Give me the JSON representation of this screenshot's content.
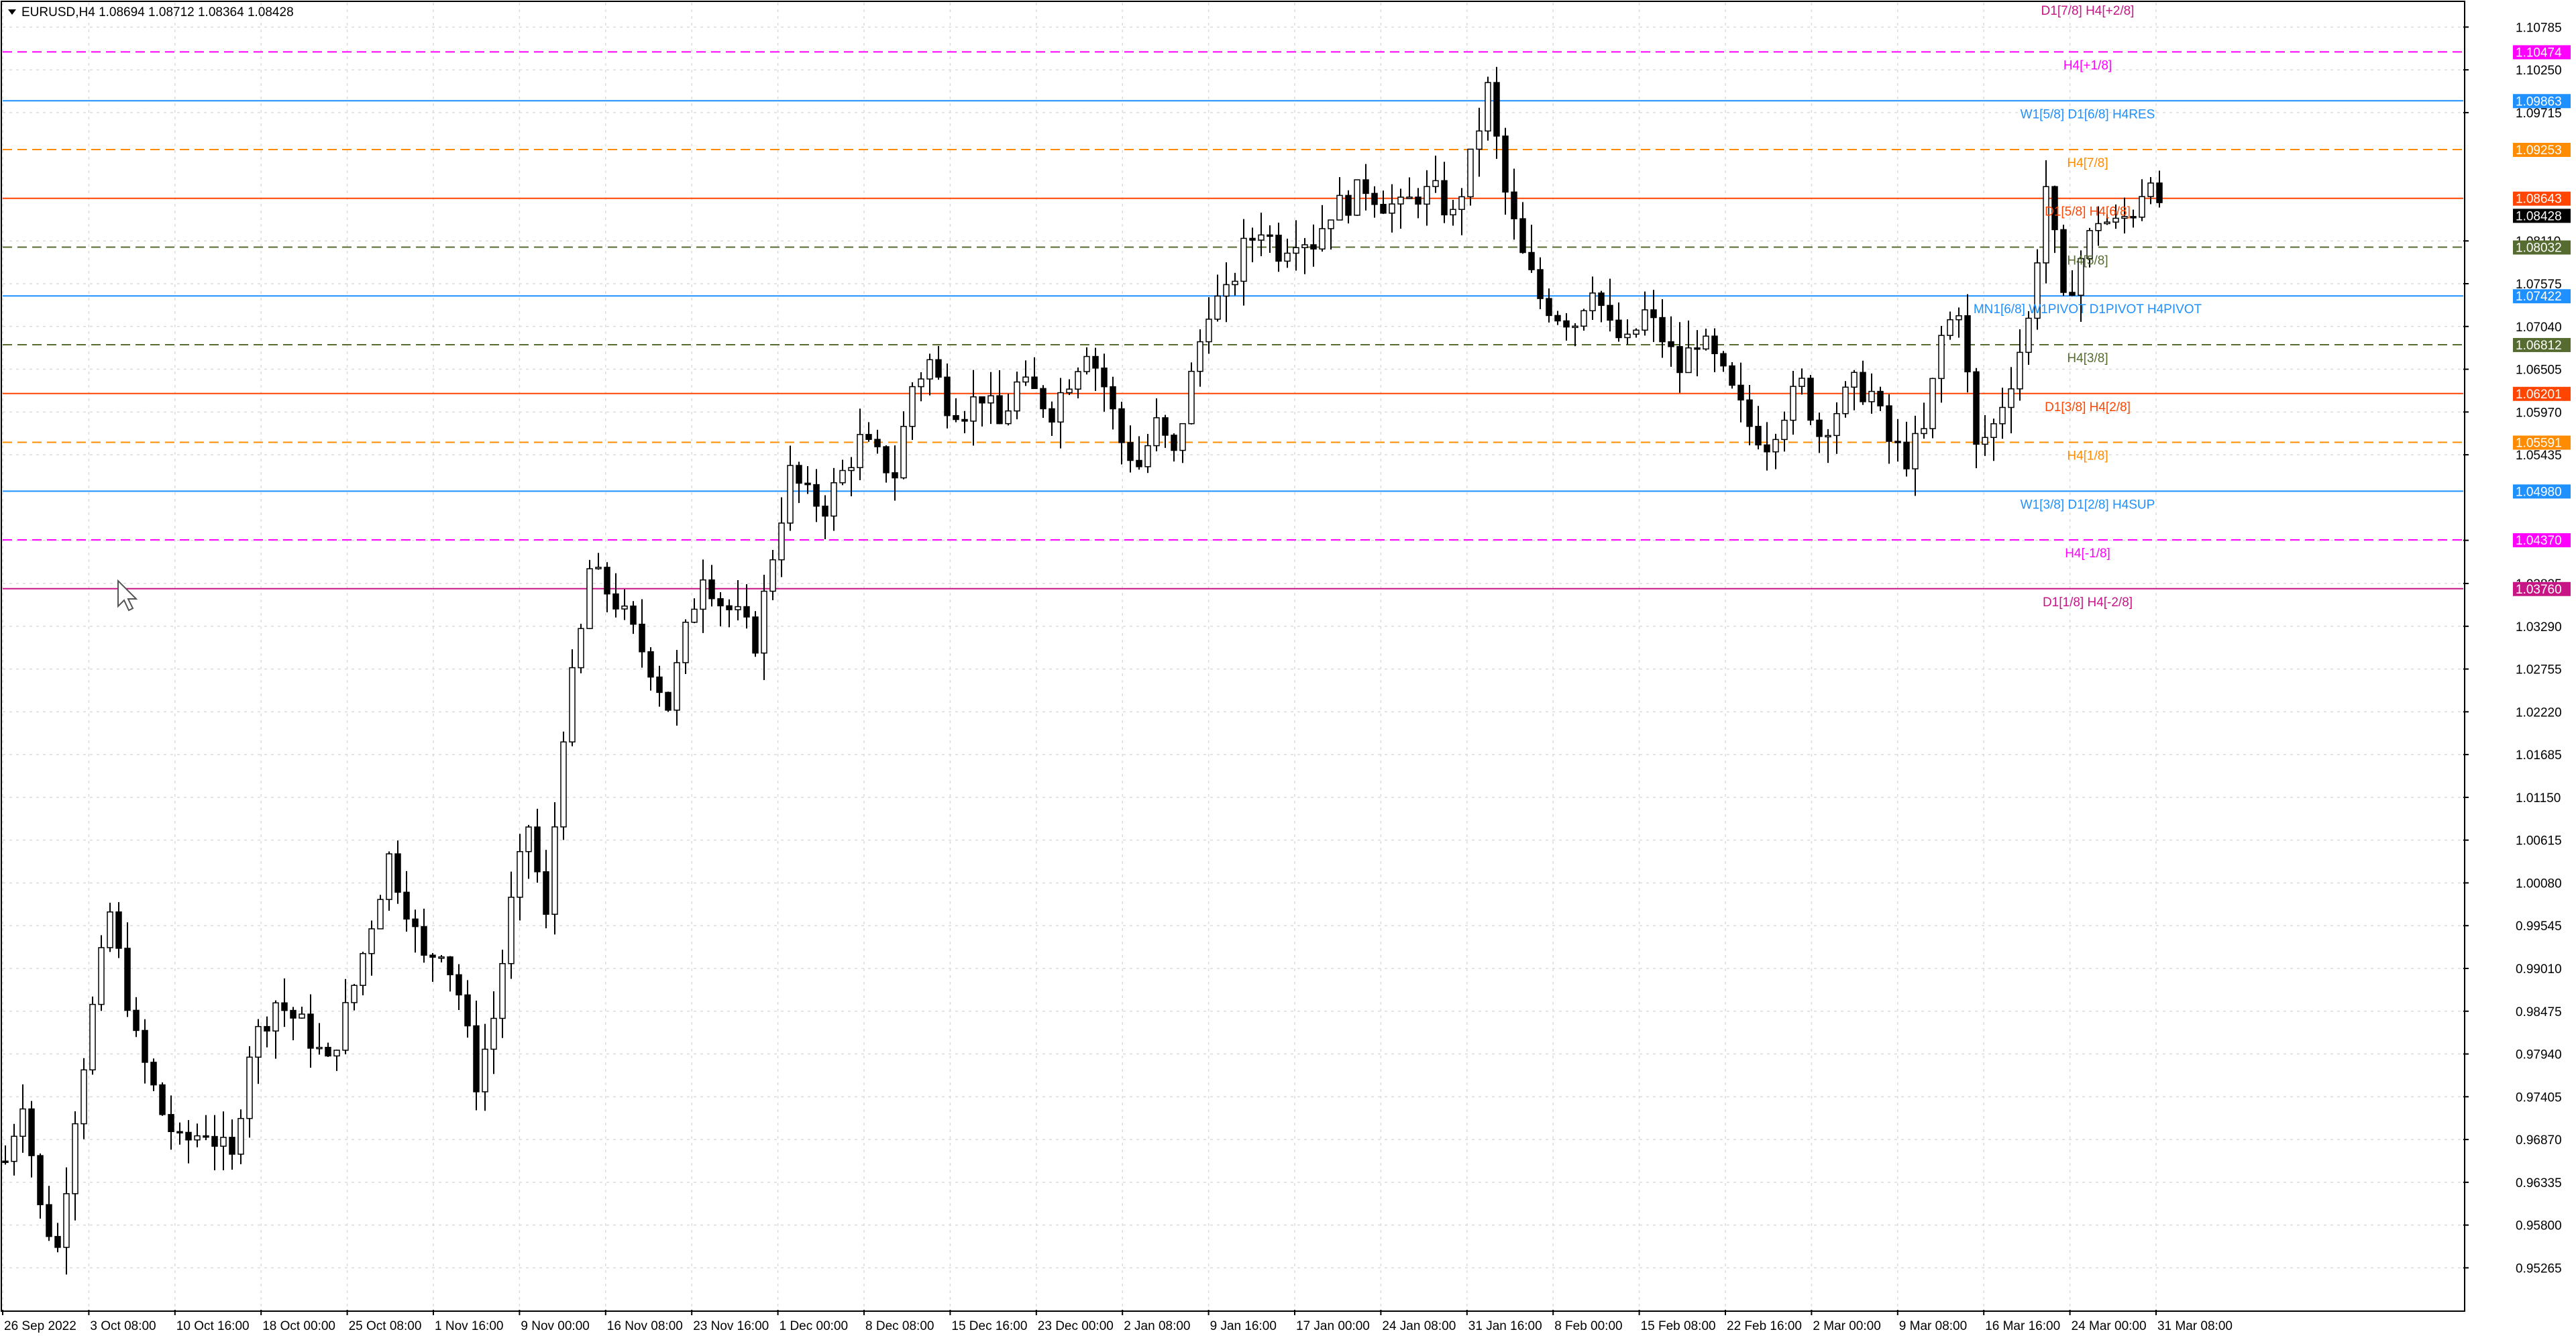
{
  "window": {
    "symbol_line": "EURUSD,H4  1.08694 1.08712 1.08364 1.08428",
    "menu_arrow_icon": "triangle-down-icon"
  },
  "colors": {
    "background": "#ffffff",
    "grid": "#d8d8d8",
    "candles": "#000000",
    "axis": "#000000"
  },
  "chart_data": {
    "type": "candlestick",
    "symbol": "EURUSD",
    "timeframe": "H4",
    "ohlc_last": {
      "open": 1.08694,
      "high": 1.08712,
      "low": 1.08364,
      "close": 1.08428
    },
    "current_price": "1.08428",
    "ylim": [
      0.9474,
      1.1109
    ],
    "y_ticks": [
      "1.10785",
      "1.10250",
      "1.09715",
      "1.08110",
      "1.07575",
      "1.07040",
      "1.06505",
      "1.05970",
      "1.05435",
      "1.04365",
      "1.03825",
      "1.03290",
      "1.02755",
      "1.02220",
      "1.01685",
      "1.01150",
      "1.00615",
      "1.00080",
      "0.99545",
      "0.99010",
      "0.98475",
      "0.97940",
      "0.97405",
      "0.96870",
      "0.96335",
      "0.95800",
      "0.95265"
    ],
    "x_ticks": [
      "26 Sep 2022",
      "3 Oct 08:00",
      "10 Oct 16:00",
      "18 Oct 00:00",
      "25 Oct 08:00",
      "1 Nov 16:00",
      "9 Nov 00:00",
      "16 Nov 08:00",
      "23 Nov 16:00",
      "1 Dec 00:00",
      "8 Dec 08:00",
      "15 Dec 16:00",
      "23 Dec 00:00",
      "2 Jan 08:00",
      "9 Jan 16:00",
      "17 Jan 00:00",
      "24 Jan 08:00",
      "31 Jan 16:00",
      "8 Feb 00:00",
      "15 Feb 08:00",
      "22 Feb 16:00",
      "2 Mar 00:00",
      "9 Mar 08:00",
      "16 Mar 16:00",
      "24 Mar 00:00",
      "31 Mar 08:00"
    ],
    "close_path": [
      [
        0,
        0.966
      ],
      [
        2,
        0.974
      ],
      [
        4,
        0.96
      ],
      [
        6,
        0.955
      ],
      [
        8,
        0.972
      ],
      [
        10,
        0.985
      ],
      [
        12,
        0.997
      ],
      [
        15,
        0.981
      ],
      [
        18,
        0.972
      ],
      [
        20,
        0.968
      ],
      [
        23,
        0.97
      ],
      [
        26,
        0.966
      ],
      [
        28,
        0.98
      ],
      [
        31,
        0.986
      ],
      [
        34,
        0.983
      ],
      [
        37,
        0.978
      ],
      [
        40,
        0.988
      ],
      [
        42,
        0.996
      ],
      [
        44,
        1.004
      ],
      [
        46,
        0.998
      ],
      [
        48,
        0.991
      ],
      [
        50,
        0.993
      ],
      [
        52,
        0.987
      ],
      [
        54,
        0.976
      ],
      [
        56,
        0.984
      ],
      [
        58,
        0.998
      ],
      [
        60,
        1.008
      ],
      [
        62,
        0.996
      ],
      [
        64,
        1.02
      ],
      [
        66,
        1.032
      ],
      [
        67,
        1.04
      ],
      [
        70,
        1.036
      ],
      [
        72,
        1.032
      ],
      [
        74,
        1.028
      ],
      [
        76,
        1.023
      ],
      [
        78,
        1.032
      ],
      [
        80,
        1.04
      ],
      [
        82,
        1.036
      ],
      [
        84,
        1.034
      ],
      [
        86,
        1.031
      ],
      [
        88,
        1.042
      ],
      [
        90,
        1.052
      ],
      [
        92,
        1.049
      ],
      [
        94,
        1.048
      ],
      [
        96,
        1.052
      ],
      [
        98,
        1.056
      ],
      [
        100,
        1.054
      ],
      [
        102,
        1.052
      ],
      [
        104,
        1.063
      ],
      [
        106,
        1.066
      ],
      [
        108,
        1.061
      ],
      [
        110,
        1.06
      ],
      [
        112,
        1.062
      ],
      [
        114,
        1.058
      ],
      [
        116,
        1.063
      ],
      [
        118,
        1.062
      ],
      [
        120,
        1.06
      ],
      [
        122,
        1.064
      ],
      [
        124,
        1.068
      ],
      [
        126,
        1.063
      ],
      [
        128,
        1.056
      ],
      [
        130,
        1.053
      ],
      [
        132,
        1.058
      ],
      [
        134,
        1.054
      ],
      [
        136,
        1.064
      ],
      [
        138,
        1.073
      ],
      [
        140,
        1.074
      ],
      [
        142,
        1.08
      ],
      [
        144,
        1.083
      ],
      [
        146,
        1.08
      ],
      [
        148,
        1.082
      ],
      [
        150,
        1.081
      ],
      [
        152,
        1.085
      ],
      [
        154,
        1.086
      ],
      [
        156,
        1.088
      ],
      [
        158,
        1.086
      ],
      [
        160,
        1.085
      ],
      [
        162,
        1.087
      ],
      [
        164,
        1.087
      ],
      [
        166,
        1.084
      ],
      [
        168,
        1.091
      ],
      [
        170,
        1.1
      ],
      [
        172,
        1.087
      ],
      [
        174,
        1.079
      ],
      [
        176,
        1.074
      ],
      [
        178,
        1.072
      ],
      [
        180,
        1.071
      ],
      [
        182,
        1.076
      ],
      [
        184,
        1.07
      ],
      [
        186,
        1.068
      ],
      [
        188,
        1.072
      ],
      [
        190,
        1.069
      ],
      [
        192,
        1.065
      ],
      [
        194,
        1.069
      ],
      [
        196,
        1.066
      ],
      [
        198,
        1.062
      ],
      [
        200,
        1.058
      ],
      [
        202,
        1.056
      ],
      [
        204,
        1.06
      ],
      [
        206,
        1.063
      ],
      [
        208,
        1.057
      ],
      [
        210,
        1.06
      ],
      [
        212,
        1.063
      ],
      [
        214,
        1.062
      ],
      [
        216,
        1.056
      ],
      [
        218,
        1.054
      ],
      [
        220,
        1.057
      ],
      [
        222,
        1.069
      ],
      [
        224,
        1.073
      ],
      [
        226,
        1.055
      ],
      [
        228,
        1.058
      ],
      [
        230,
        1.064
      ],
      [
        232,
        1.071
      ],
      [
        234,
        1.088
      ],
      [
        235,
        1.081
      ],
      [
        236,
        1.073
      ],
      [
        238,
        1.079
      ],
      [
        240,
        1.084
      ],
      [
        242,
        1.083
      ],
      [
        244,
        1.085
      ],
      [
        246,
        1.09
      ],
      [
        247,
        1.08428
      ]
    ],
    "levels": [
      {
        "price": 1.10474,
        "label": "H4[+1/8]",
        "tag": "1.10474",
        "color": "#ff00ff",
        "dash": true
      },
      {
        "price": 1.09863,
        "label": "W1[5/8] D1[6/8] H4RES",
        "tag": "1.09863",
        "color": "#1e90ff",
        "dash": false
      },
      {
        "price": 1.09253,
        "label": "H4[7/8]",
        "tag": "1.09253",
        "color": "#ff8c00",
        "dash": true
      },
      {
        "price": 1.08643,
        "label": "D1[5/8] H4[6/8]",
        "tag": "1.08643",
        "color": "#ff4500",
        "dash": false
      },
      {
        "price": 1.08032,
        "label": "H4[5/8]",
        "tag": "1.08032",
        "color": "#556b2f",
        "dash": true
      },
      {
        "price": 1.07422,
        "label": "MN1[6/8] W1PIVOT D1PIVOT H4PIVOT",
        "tag": "1.07422",
        "color": "#1e90ff",
        "dash": false
      },
      {
        "price": 1.06812,
        "label": "H4[3/8]",
        "tag": "1.06812",
        "color": "#556b2f",
        "dash": true
      },
      {
        "price": 1.06201,
        "label": "D1[3/8] H4[2/8]",
        "tag": "1.06201",
        "color": "#ff4500",
        "dash": false
      },
      {
        "price": 1.05591,
        "label": "H4[1/8]",
        "tag": "1.05591",
        "color": "#ff8c00",
        "dash": true
      },
      {
        "price": 1.0498,
        "label": "W1[3/8] D1[2/8] H4SUP",
        "tag": "1.04980",
        "color": "#1e90ff",
        "dash": false
      },
      {
        "price": 1.0437,
        "label": "H4[-1/8]",
        "tag": "1.04370",
        "color": "#ff00ff",
        "dash": true
      },
      {
        "price": 1.0376,
        "label": "D1[1/8] H4[-2/8]",
        "tag": "1.03760",
        "color": "#c71585",
        "dash": false
      },
      {
        "price": 1.111,
        "label": "D1[7/8] H4[+2/8]",
        "tag": "",
        "color": "#c71585",
        "dash": false
      }
    ]
  }
}
